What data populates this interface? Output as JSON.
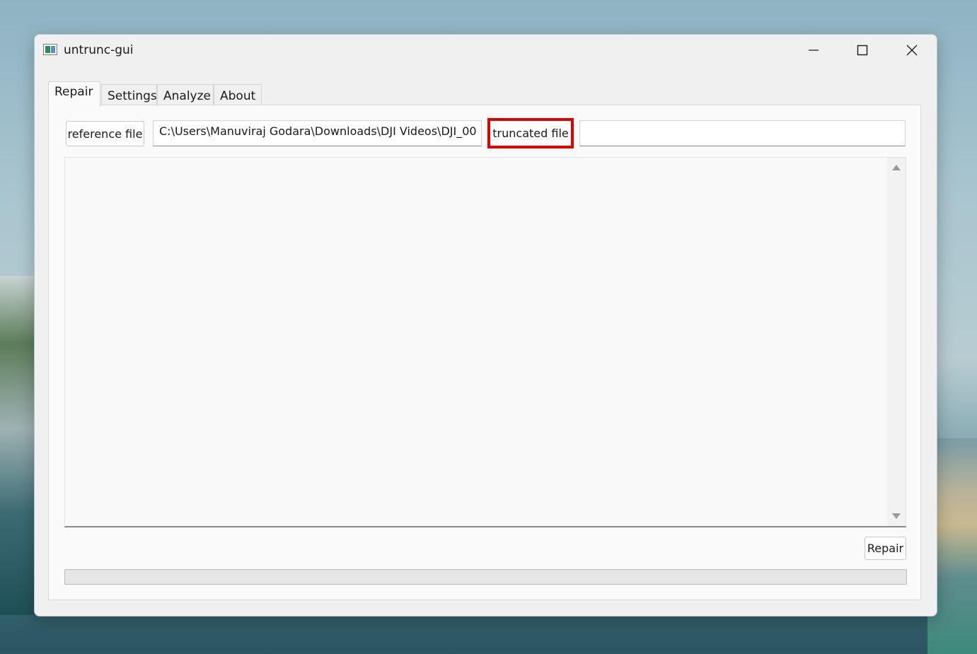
{
  "window": {
    "title": "untrunc-gui",
    "icon": "app-window-icon",
    "controls": [
      "minimize-icon",
      "maximize-icon",
      "close-icon"
    ]
  },
  "tabs": [
    {
      "label": "Repair",
      "active": true
    },
    {
      "label": "Settings",
      "active": false
    },
    {
      "label": "Analyze",
      "active": false
    },
    {
      "label": "About",
      "active": false
    }
  ],
  "repair": {
    "reference_button": "reference file",
    "reference_path": "C:\\Users\\Manuviraj Godara\\Downloads\\DJI Videos\\DJI_00",
    "truncated_button": "truncated file",
    "truncated_path": "",
    "log_text": "",
    "repair_button": "Repair",
    "progress": 0
  },
  "colors": {
    "highlight": "#e00000",
    "window_bg": "#f0f0f0",
    "panel_bg": "#fafafa"
  }
}
